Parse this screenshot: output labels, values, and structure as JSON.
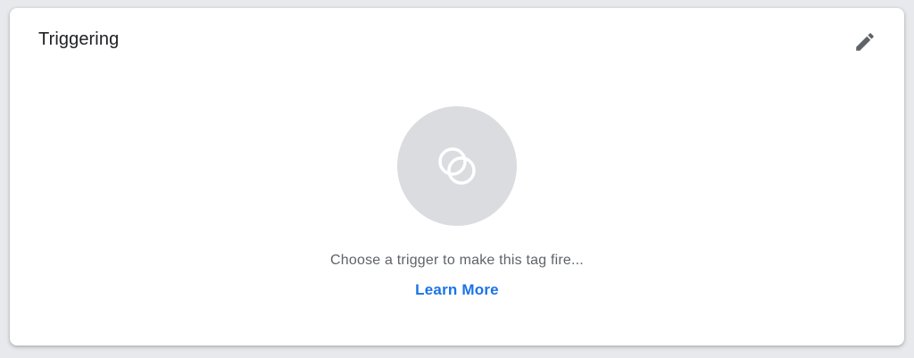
{
  "card": {
    "title": "Triggering",
    "edit_icon": "pencil-icon",
    "empty_state": {
      "icon": "trigger-circles-icon",
      "hint": "Choose a trigger to make this tag fire...",
      "link_label": "Learn More"
    }
  },
  "colors": {
    "page_background": "#e8e9ec",
    "card_background": "#ffffff",
    "title_text": "#202124",
    "hint_text": "#5f6368",
    "link": "#1a73e8",
    "icon_circle": "#dadce0",
    "edit_icon": "#5f6368"
  }
}
